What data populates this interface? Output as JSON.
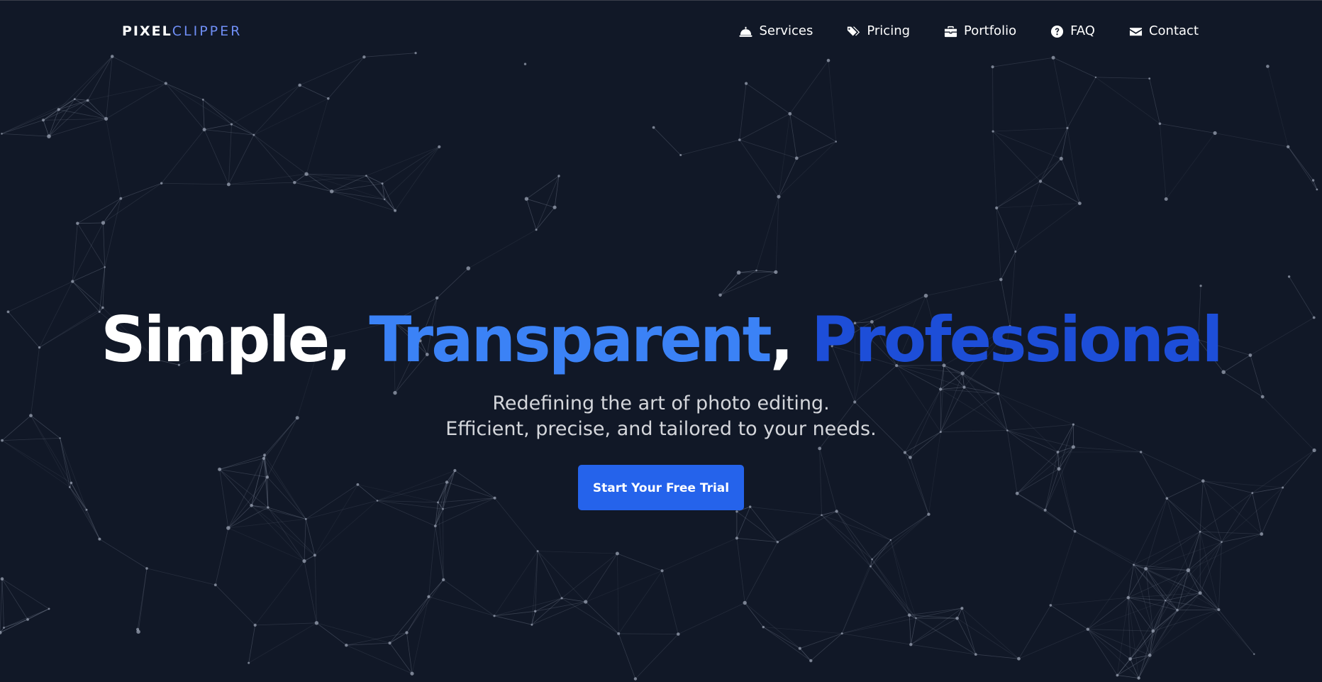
{
  "brand": {
    "logo_part1": "PIXEL",
    "logo_part2": "CLIPPER"
  },
  "nav": {
    "items": [
      {
        "label": "Services",
        "icon": "bell-concierge-icon"
      },
      {
        "label": "Pricing",
        "icon": "tags-icon"
      },
      {
        "label": "Portfolio",
        "icon": "briefcase-icon"
      },
      {
        "label": "FAQ",
        "icon": "question-circle-icon"
      },
      {
        "label": "Contact",
        "icon": "envelope-icon"
      }
    ]
  },
  "hero": {
    "headline_word1": "Simple,",
    "headline_word2": "Transparent",
    "headline_comma": ",",
    "headline_word3": "Professional",
    "subtitle_line1": "Redefining the art of photo editing.",
    "subtitle_line2": "Efficient, precise, and tailored to your needs.",
    "cta_label": "Start Your Free Trial"
  },
  "colors": {
    "background": "#111827",
    "accent_light": "#3b82f6",
    "accent_dark": "#1d4ed8",
    "button": "#2563eb",
    "logo_accent": "#6f8ef5"
  }
}
